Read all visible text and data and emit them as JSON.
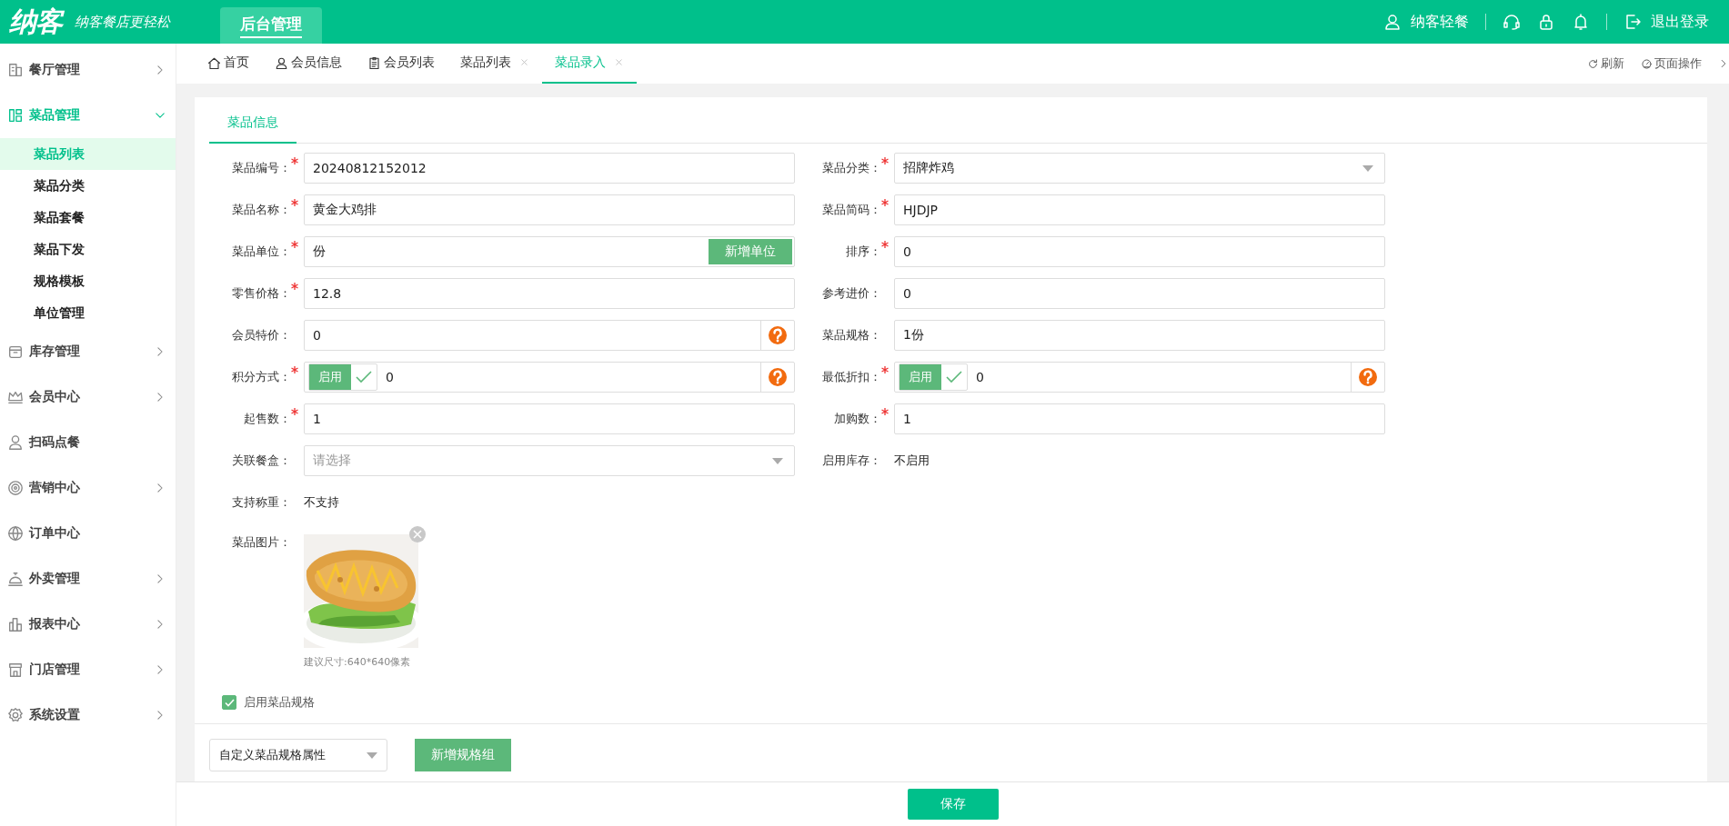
{
  "header": {
    "logo": "纳客",
    "slogan": "纳客餐店更轻松",
    "nav": [
      {
        "label": "后台管理",
        "selected": true
      }
    ],
    "user": "纳客轻餐",
    "logout": "退出登录"
  },
  "sidebar": {
    "items": [
      {
        "label": "餐厅管理",
        "has_submenu": true,
        "expanded": false
      },
      {
        "label": "菜品管理",
        "has_submenu": true,
        "expanded": true,
        "children": [
          {
            "label": "菜品列表",
            "selected": true
          },
          {
            "label": "菜品分类",
            "selected": false
          },
          {
            "label": "菜品套餐",
            "selected": false
          },
          {
            "label": "菜品下发",
            "selected": false
          },
          {
            "label": "规格模板",
            "selected": false
          },
          {
            "label": "单位管理",
            "selected": false
          }
        ]
      },
      {
        "label": "库存管理",
        "has_submenu": true,
        "expanded": false
      },
      {
        "label": "会员中心",
        "has_submenu": true,
        "expanded": false
      },
      {
        "label": "扫码点餐",
        "has_submenu": false,
        "expanded": false
      },
      {
        "label": "营销中心",
        "has_submenu": true,
        "expanded": false
      },
      {
        "label": "订单中心",
        "has_submenu": false,
        "expanded": false
      },
      {
        "label": "外卖管理",
        "has_submenu": true,
        "expanded": false
      },
      {
        "label": "报表中心",
        "has_submenu": true,
        "expanded": false
      },
      {
        "label": "门店管理",
        "has_submenu": true,
        "expanded": false
      },
      {
        "label": "系统设置",
        "has_submenu": true,
        "expanded": false
      }
    ]
  },
  "tabs": [
    {
      "label": "首页",
      "selected": false,
      "closable": false
    },
    {
      "label": "会员信息",
      "selected": false,
      "closable": false
    },
    {
      "label": "会员列表",
      "selected": false,
      "closable": false
    },
    {
      "label": "菜品列表",
      "selected": false,
      "closable": true
    },
    {
      "label": "菜品录入",
      "selected": true,
      "closable": true
    }
  ],
  "tab_actions": [
    "刷新",
    "页面操作"
  ],
  "form": {
    "section_tabs": [
      {
        "label": "菜品信息",
        "selected": true
      }
    ],
    "fields": [
      {
        "label": "菜品编号：",
        "required": true,
        "kind": "text",
        "value": "20240812152012"
      },
      {
        "label": "菜品分类：",
        "required": true,
        "kind": "select",
        "value": "招牌炸鸡"
      },
      {
        "label": "菜品名称：",
        "required": true,
        "kind": "text",
        "value": "黄金大鸡排"
      },
      {
        "label": "菜品简码：",
        "required": true,
        "kind": "text",
        "value": "HJDJP"
      },
      {
        "label": "菜品单位：",
        "required": true,
        "kind": "button",
        "value": "份",
        "button": "新增单位"
      },
      {
        "label": "排序：",
        "required": true,
        "kind": "text",
        "value": "0"
      },
      {
        "label": "零售价格：",
        "required": true,
        "kind": "text",
        "value": "12.8"
      },
      {
        "label": "参考进价：",
        "required": false,
        "kind": "text",
        "value": "0"
      },
      {
        "label": "会员特价：",
        "required": false,
        "kind": "help",
        "value": "0"
      },
      {
        "label": "菜品规格：",
        "required": false,
        "kind": "text",
        "value": "1份"
      },
      {
        "label": "积分方式：",
        "required": true,
        "kind": "toggle",
        "toggle": "启用",
        "checked": true,
        "value": "0"
      },
      {
        "label": "最低折扣：",
        "required": true,
        "kind": "toggle",
        "toggle": "启用",
        "checked": true,
        "value": "0"
      },
      {
        "label": "起售数：",
        "required": true,
        "kind": "text",
        "value": "1"
      },
      {
        "label": "加购数：",
        "required": true,
        "kind": "text",
        "value": "1"
      },
      {
        "label": "关联餐盒：",
        "required": false,
        "kind": "select",
        "placeholder": "请选择"
      },
      {
        "label": "启用库存：",
        "required": false,
        "kind": "static",
        "value": "不启用"
      },
      {
        "label": "支持称重：",
        "required": false,
        "kind": "static",
        "value": "不支持"
      }
    ],
    "image": {
      "label": "菜品图片：",
      "kind": "picture",
      "hint": "建议尺寸:640*640像素"
    },
    "spec_toggle": {
      "label": "启用菜品规格",
      "checked": true
    },
    "spec_select": {
      "value": "自定义菜品规格属性"
    },
    "spec_button": "新增规格组"
  },
  "footer": {
    "button": "保存"
  }
}
